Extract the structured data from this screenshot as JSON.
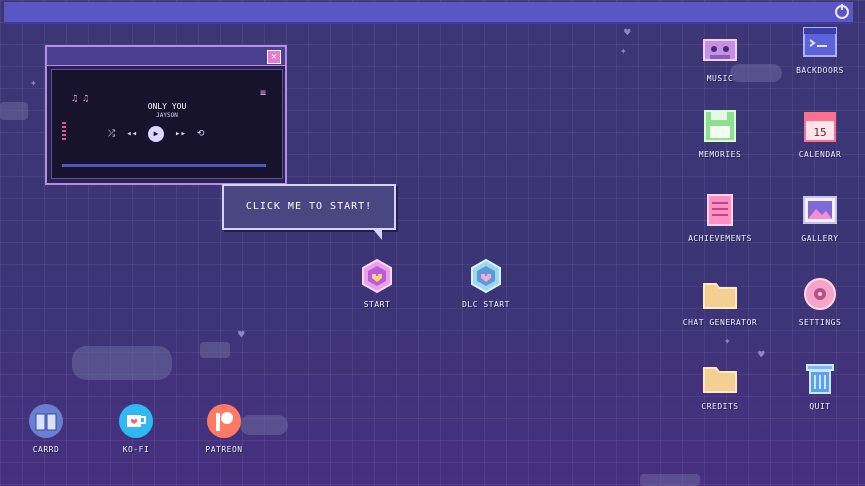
{
  "player": {
    "song_title": "ONLY YOU",
    "artist": "JAYSON",
    "notes_glyph": "♫ ♫",
    "menu_glyph": "≡",
    "shuffle_glyph": "⤮",
    "prev_glyph": "◂◂",
    "play_glyph": "▶",
    "next_glyph": "▸▸",
    "repeat_glyph": "⟲",
    "close_glyph": "✕"
  },
  "bubble": {
    "text": "CLICK ME TO START!"
  },
  "center": {
    "start_label": "START",
    "dlc_label": "DLC START"
  },
  "desktop_right": [
    {
      "label": "MUSIC",
      "icon": "cassette-icon"
    },
    {
      "label": "BACKDOORS",
      "icon": "terminal-icon"
    },
    {
      "label": "MEMORIES",
      "icon": "floppy-disk-icon"
    },
    {
      "label": "CALENDAR",
      "icon": "calendar-icon",
      "day": "15"
    },
    {
      "label": "ACHIEVEMENTS",
      "icon": "notepad-icon"
    },
    {
      "label": "GALLERY",
      "icon": "picture-icon"
    },
    {
      "label": "CHAT GENERATOR",
      "icon": "folder-icon"
    },
    {
      "label": "SETTINGS",
      "icon": "gear-icon"
    },
    {
      "label": "CREDITS",
      "icon": "folder-icon"
    },
    {
      "label": "QUIT",
      "icon": "trash-can-icon"
    }
  ],
  "desktop_bottom": [
    {
      "label": "CARRD",
      "icon": "book-icon"
    },
    {
      "label": "KO-FI",
      "icon": "coffee-cup-icon"
    },
    {
      "label": "PATREON",
      "icon": "patreon-icon"
    }
  ],
  "colors": {
    "background": "#3a3477",
    "topbar": "#5a56c4",
    "accent_pink": "#e77ad5"
  }
}
